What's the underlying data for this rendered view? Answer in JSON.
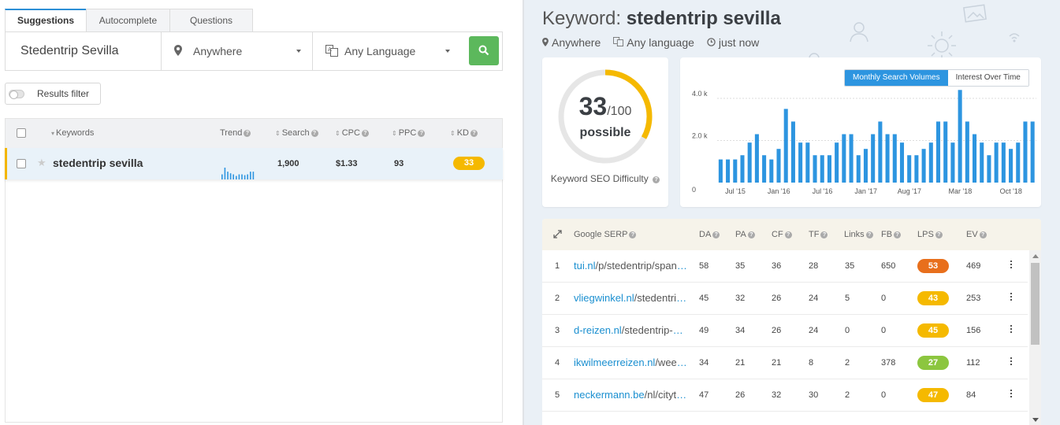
{
  "tabs": [
    "Suggestions",
    "Autocomplete",
    "Questions"
  ],
  "search": {
    "keyword": "Stedentrip Sevilla",
    "location": "Anywhere",
    "language": "Any Language"
  },
  "filter_label": "Results filter",
  "kw_table": {
    "headers": {
      "keywords": "Keywords",
      "trend": "Trend",
      "search": "Search",
      "cpc": "CPC",
      "ppc": "PPC",
      "kd": "KD"
    },
    "row": {
      "keyword": "stedentrip sevilla",
      "search": "1,900",
      "cpc": "$1.33",
      "ppc": "93",
      "kd": "33"
    }
  },
  "detail": {
    "title_prefix": "Keyword:",
    "keyword": "stedentrip sevilla",
    "location": "Anywhere",
    "language": "Any language",
    "time": "just now"
  },
  "kd_card": {
    "score": "33",
    "max": "/100",
    "word": "possible",
    "label": "Keyword SEO Difficulty",
    "score_value": 33,
    "color": "#f5b900"
  },
  "chart_data": {
    "type": "bar",
    "buttons": [
      "Monthly Search Volumes",
      "Interest Over Time"
    ],
    "y_ticks": [
      "0",
      "2.0 k",
      "4.0 k"
    ],
    "ylim": [
      0,
      4600
    ],
    "x_labels": [
      "Jul '15",
      "Jan '16",
      "Jul '16",
      "Jan '17",
      "Aug '17",
      "Mar '18",
      "Oct '18"
    ],
    "x_label_index": [
      2,
      8,
      14,
      20,
      26,
      33,
      40
    ],
    "values": [
      1100,
      1100,
      1100,
      1300,
      1900,
      2300,
      1300,
      1100,
      1600,
      3500,
      2900,
      1900,
      1900,
      1300,
      1300,
      1300,
      1900,
      2300,
      2300,
      1300,
      1600,
      2300,
      2900,
      2300,
      2300,
      1900,
      1300,
      1300,
      1600,
      1900,
      2900,
      2900,
      1900,
      4400,
      2900,
      2300,
      1900,
      1300,
      1900,
      1900,
      1600,
      1900,
      2900,
      2900
    ],
    "bar_color": "#2d95e0"
  },
  "serp": {
    "headers": {
      "serp": "Google SERP",
      "da": "DA",
      "pa": "PA",
      "cf": "CF",
      "tf": "TF",
      "links": "Links",
      "fb": "FB",
      "lps": "LPS",
      "ev": "EV"
    },
    "rows": [
      {
        "n": "1",
        "domain": "tui.nl",
        "path": "/p/stedentrip/spanje/sevilla",
        "da": "58",
        "pa": "35",
        "cf": "36",
        "tf": "28",
        "links": "35",
        "fb": "650",
        "lps": "53",
        "lps_color": "#e86f1c",
        "ev": "469"
      },
      {
        "n": "2",
        "domain": "vliegwinkel.nl",
        "path": "/stedentrip-sevilla",
        "da": "45",
        "pa": "32",
        "cf": "26",
        "tf": "24",
        "links": "5",
        "fb": "0",
        "lps": "43",
        "lps_color": "#f5b900",
        "ev": "253"
      },
      {
        "n": "3",
        "domain": "d-reizen.nl",
        "path": "/stedentrip-sevilla",
        "da": "49",
        "pa": "34",
        "cf": "26",
        "tf": "24",
        "links": "0",
        "fb": "0",
        "lps": "45",
        "lps_color": "#f5b900",
        "ev": "156"
      },
      {
        "n": "4",
        "domain": "ikwilmeerreizen.nl",
        "path": "/weekendje-sevilla",
        "da": "34",
        "pa": "21",
        "cf": "21",
        "tf": "8",
        "links": "2",
        "fb": "378",
        "lps": "27",
        "lps_color": "#8cc63f",
        "ev": "112"
      },
      {
        "n": "5",
        "domain": "neckermann.be",
        "path": "/nl/citytrip/sevilla",
        "da": "47",
        "pa": "26",
        "cf": "32",
        "tf": "30",
        "links": "2",
        "fb": "0",
        "lps": "47",
        "lps_color": "#f5b900",
        "ev": "84"
      }
    ]
  },
  "icons": [
    "map-pin-icon",
    "language-icon",
    "clock-icon",
    "search-icon",
    "star-icon",
    "expand-icon",
    "more-icon"
  ]
}
